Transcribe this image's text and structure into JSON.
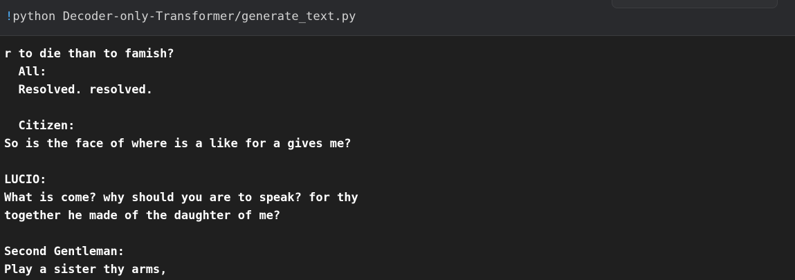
{
  "code_cell": {
    "bang": "!",
    "command": "python Decoder-only-Transformer/generate_text.py"
  },
  "output": {
    "lines": [
      "r to die than to famish?",
      "  All:",
      "  Resolved. resolved.",
      "",
      "  Citizen:",
      "So is the face of where is a like for a gives me?",
      "",
      "LUCIO:",
      "What is come? why should you are to speak? for thy",
      "together he made of the daughter of me?",
      "",
      "Second Gentleman:",
      "Play a sister thy arms,"
    ]
  },
  "colors": {
    "background": "#1f1f1f",
    "cell_background": "#292a2d",
    "bang_accent": "#4fb3ff",
    "output_text": "#ffffff"
  }
}
